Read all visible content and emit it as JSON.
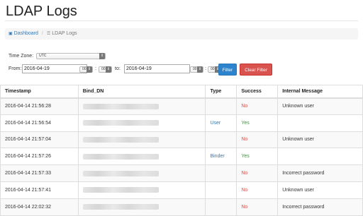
{
  "page": {
    "title": "LDAP Logs"
  },
  "breadcrumb": {
    "home_icon": "dashboard-icon",
    "home_label": "Dashboard",
    "current_icon": "list-icon",
    "current_label": "LDAP Logs"
  },
  "filter": {
    "timezone_label": "Time Zone:",
    "timezone_value": "UTC",
    "from_label": "From:",
    "from_date": "2016-04-19",
    "from_hour": "00",
    "from_minute": "00",
    "to_label": "to:",
    "to_date": "2016-04-19",
    "to_hour": "00",
    "to_minute": "00",
    "filter_button": "Filter",
    "clear_button": "Clear Filter"
  },
  "table": {
    "columns": [
      "Timestamp",
      "Bind_DN",
      "Type",
      "Success",
      "Internal Message"
    ],
    "rows": [
      {
        "timestamp": "2016-04-14 21:56:28",
        "type": "",
        "success": "No",
        "message": "Unknown user"
      },
      {
        "timestamp": "2016-04-14 21:56:54",
        "type": "User",
        "success": "Yes",
        "message": ""
      },
      {
        "timestamp": "2016-04-14 21:57:04",
        "type": "",
        "success": "No",
        "message": "Unknown user"
      },
      {
        "timestamp": "2016-04-14 21:57:26",
        "type": "Binder",
        "success": "Yes",
        "message": ""
      },
      {
        "timestamp": "2016-04-14 21:57:33",
        "type": "",
        "success": "No",
        "message": "Incorrect password"
      },
      {
        "timestamp": "2016-04-14 21:57:41",
        "type": "",
        "success": "No",
        "message": "Unknown user"
      },
      {
        "timestamp": "2016-04-14 22:02:32",
        "type": "",
        "success": "No",
        "message": "Incorrect password"
      }
    ]
  },
  "colors": {
    "link": "#337ab7",
    "success_yes": "#3c9a3c",
    "success_no": "#d9534f",
    "filter_button": "#2e84cc",
    "clear_button": "#d9534f"
  }
}
